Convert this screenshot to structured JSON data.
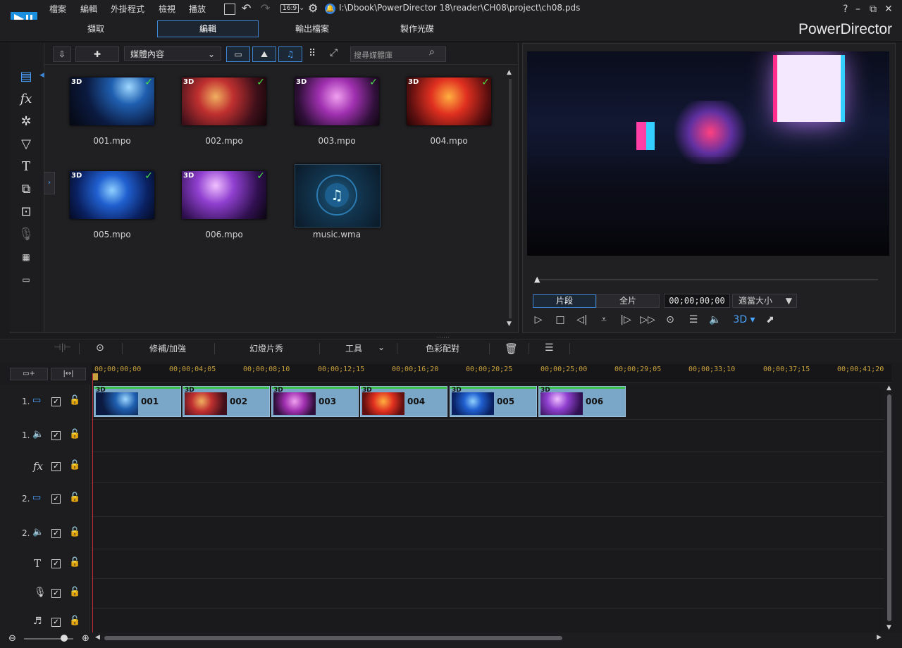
{
  "menu": {
    "items": [
      "檔案",
      "編輯",
      "外掛程式",
      "檢視",
      "播放"
    ],
    "aspect": "16:9",
    "path": "I:\\Dbook\\PowerDirector 18\\reader\\CH08\\project\\ch08.pds",
    "help": "?",
    "minimize": "–",
    "restore": "⧉",
    "close": "✕"
  },
  "tabs": [
    "擷取",
    "編輯",
    "輸出檔案",
    "製作光碟"
  ],
  "brand": "PowerDirector",
  "library": {
    "dropdown": "媒體內容",
    "search_placeholder": "搜尋媒體庫",
    "items": [
      {
        "label": "001.mpo",
        "badge": "3D",
        "check": "✓"
      },
      {
        "label": "002.mpo",
        "badge": "3D",
        "check": "✓"
      },
      {
        "label": "003.mpo",
        "badge": "3D",
        "check": "✓"
      },
      {
        "label": "004.mpo",
        "badge": "3D",
        "check": "✓"
      },
      {
        "label": "005.mpo",
        "badge": "3D",
        "check": "✓"
      },
      {
        "label": "006.mpo",
        "badge": "3D",
        "check": "✓"
      },
      {
        "label": "music.wma",
        "badge": "",
        "check": ""
      }
    ]
  },
  "preview": {
    "clip_btn": "片段",
    "movie_btn": "全片",
    "timecode": "00;00;00;00",
    "zoom": "適當大小",
    "mode_3d": "3D"
  },
  "timeline_toolbar": {
    "fix": "修補/加強",
    "slideshow": "幻燈片秀",
    "tools": "工具",
    "color": "色彩配對"
  },
  "ruler": [
    "00;00;00;00",
    "00;00;04;05",
    "00;00;08;10",
    "00;00;12;15",
    "00;00;16;20",
    "00;00;20;25",
    "00;00;25;00",
    "00;00;29;05",
    "00;00;33;10",
    "00;00;37;15",
    "00;00;41;20"
  ],
  "tracks": [
    {
      "num": "1.",
      "icon": "video-track-icon"
    },
    {
      "num": "1.",
      "icon": "audio-track-icon"
    },
    {
      "num": "",
      "icon": "fx-track-icon"
    },
    {
      "num": "2.",
      "icon": "video-track-icon"
    },
    {
      "num": "2.",
      "icon": "audio-track-icon"
    },
    {
      "num": "",
      "icon": "title-track-icon"
    },
    {
      "num": "",
      "icon": "voice-track-icon"
    },
    {
      "num": "",
      "icon": "music-track-icon"
    }
  ],
  "clips": [
    {
      "name": "001",
      "badge": "3D"
    },
    {
      "name": "002",
      "badge": "3D"
    },
    {
      "name": "003",
      "badge": "3D"
    },
    {
      "name": "004",
      "badge": "3D"
    },
    {
      "name": "005",
      "badge": "3D"
    },
    {
      "name": "006",
      "badge": "3D"
    }
  ],
  "colors": {
    "accent": "#3c86d4",
    "clip": "#7aa6c8",
    "playhead": "#c0303a",
    "check": "#46e046"
  }
}
